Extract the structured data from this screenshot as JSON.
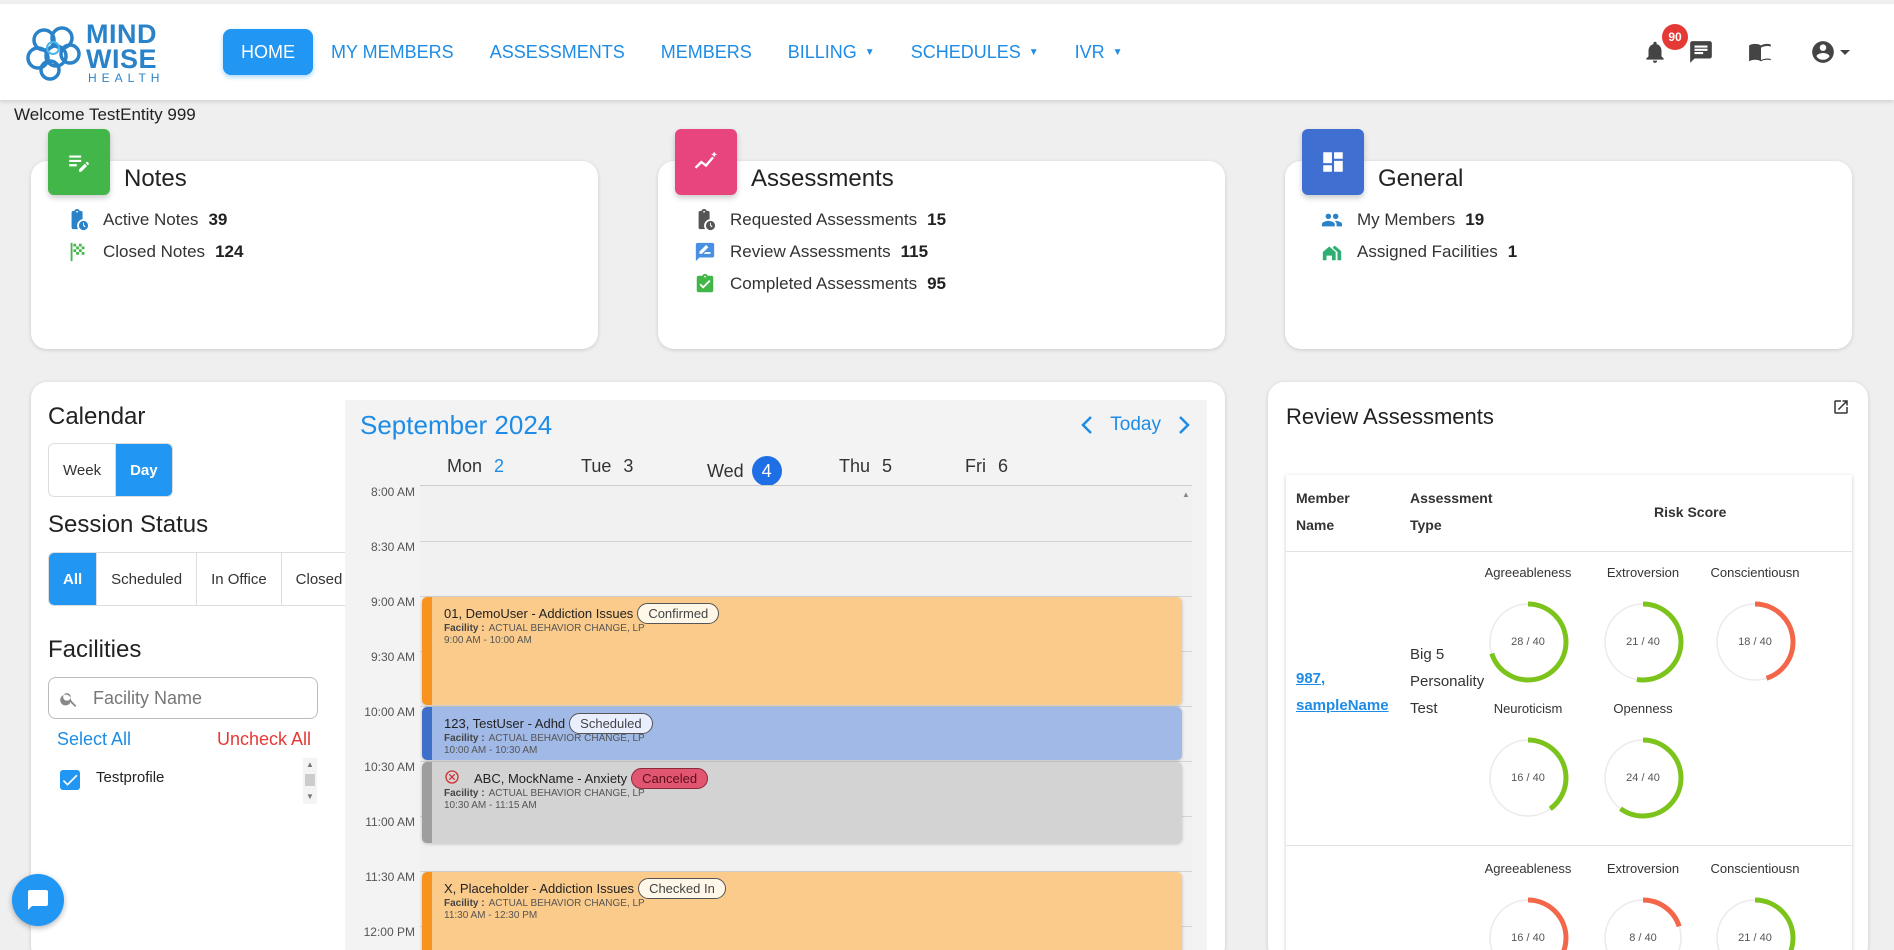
{
  "logo": {
    "line1": "MIND",
    "line2": "WISE",
    "sub": "HEALTH"
  },
  "nav": [
    {
      "label": "HOME",
      "active": true,
      "dropdown": false
    },
    {
      "label": "MY MEMBERS",
      "active": false,
      "dropdown": false
    },
    {
      "label": "ASSESSMENTS",
      "active": false,
      "dropdown": false
    },
    {
      "label": "MEMBERS",
      "active": false,
      "dropdown": false
    },
    {
      "label": "BILLING",
      "active": false,
      "dropdown": true
    },
    {
      "label": "SCHEDULES",
      "active": false,
      "dropdown": true
    },
    {
      "label": "IVR",
      "active": false,
      "dropdown": true
    }
  ],
  "notifications": {
    "count": "90"
  },
  "welcome": "Welcome TestEntity 999",
  "cards": {
    "notes": {
      "title": "Notes",
      "rows": [
        {
          "label": "Active Notes",
          "value": "39"
        },
        {
          "label": "Closed Notes",
          "value": "124"
        }
      ]
    },
    "assessments": {
      "title": "Assessments",
      "rows": [
        {
          "label": "Requested Assessments",
          "value": "15"
        },
        {
          "label": "Review Assessments",
          "value": "115"
        },
        {
          "label": "Completed Assessments",
          "value": "95"
        }
      ]
    },
    "general": {
      "title": "General",
      "rows": [
        {
          "label": "My Members",
          "value": "19"
        },
        {
          "label": "Assigned Facilities",
          "value": "1"
        }
      ]
    }
  },
  "calendar": {
    "title": "Calendar",
    "views": [
      "Week",
      "Day"
    ],
    "active_view": "Day",
    "session_status_title": "Session Status",
    "statuses": [
      "All",
      "Scheduled",
      "In Office",
      "Closed"
    ],
    "active_status": "All",
    "facilities_title": "Facilities",
    "facility_placeholder": "Facility Name",
    "select_all": "Select All",
    "uncheck_all": "Uncheck All",
    "facility_items": [
      {
        "name": "Testprofile",
        "checked": true
      }
    ],
    "month": "September 2024",
    "today": "Today",
    "days": [
      {
        "name": "Mon",
        "num": "2"
      },
      {
        "name": "Tue",
        "num": "3"
      },
      {
        "name": "Wed",
        "num": "4",
        "selected": true
      },
      {
        "name": "Thu",
        "num": "5"
      },
      {
        "name": "Fri",
        "num": "6"
      }
    ],
    "time_labels": [
      "8:00 AM",
      "8:30 AM",
      "9:00 AM",
      "9:30 AM",
      "10:00 AM",
      "10:30 AM",
      "11:00 AM",
      "11:30 AM",
      "12:00 PM"
    ],
    "events": [
      {
        "title": "01, DemoUser - Addiction Issues",
        "status": "Confirmed",
        "facility_label": "Facility :",
        "facility": "ACTUAL BEHAVIOR CHANGE, LP",
        "time": "9:00 AM - 10:00 AM",
        "color": "#fbcb8c",
        "bar": "#f7931e",
        "chip_bg": "#fff7e8",
        "canceled": false
      },
      {
        "title": "123, TestUser - Adhd",
        "status": "Scheduled",
        "facility_label": "Facility :",
        "facility": "ACTUAL BEHAVIOR CHANGE, LP",
        "time": "10:00 AM - 10:30 AM",
        "color": "#a1b9e6",
        "bar": "#3f6fc9",
        "chip_bg": "#e9efff",
        "canceled": false
      },
      {
        "title": "ABC, MockName - Anxiety",
        "status": "Canceled",
        "facility_label": "Facility :",
        "facility": "ACTUAL BEHAVIOR CHANGE, LP",
        "time": "10:30 AM - 11:15 AM",
        "color": "#d3d3d3",
        "bar": "#9e9e9e",
        "chip_bg": "#e25570",
        "canceled": true
      },
      {
        "title": "X, Placeholder - Addiction Issues",
        "status": "Checked In",
        "facility_label": "Facility :",
        "facility": "ACTUAL BEHAVIOR CHANGE, LP",
        "time": "11:30 AM - 12:30 PM",
        "color": "#fbcb8c",
        "bar": "#f7931e",
        "chip_bg": "#fff7e8",
        "canceled": false
      }
    ]
  },
  "review": {
    "title": "Review Assessments",
    "headers": {
      "member_name": "Member Name",
      "assessment_type": "Assessment Type",
      "risk_score": "Risk Score"
    },
    "rows": [
      {
        "member": "987, sampleName",
        "type": "Big 5 Personality Test",
        "traits": [
          {
            "name": "Agreeableness",
            "score": 28,
            "max": 40,
            "label": "28 / 40",
            "color": "#7cc41c"
          },
          {
            "name": "Extroversion",
            "score": 21,
            "max": 40,
            "label": "21 / 40",
            "color": "#7cc41c"
          },
          {
            "name": "Conscientiousn",
            "score": 18,
            "max": 40,
            "label": "18 / 40",
            "color": "#f4664a"
          },
          {
            "name": "Neuroticism",
            "score": 16,
            "max": 40,
            "label": "16 / 40",
            "color": "#7cc41c"
          },
          {
            "name": "Openness",
            "score": 24,
            "max": 40,
            "label": "24 / 40",
            "color": "#7cc41c"
          }
        ]
      },
      {
        "member": "",
        "type": "",
        "traits": [
          {
            "name": "Agreeableness",
            "score": 16,
            "max": 40,
            "label": "16 / 40",
            "color": "#f4664a"
          },
          {
            "name": "Extroversion",
            "score": 8,
            "max": 40,
            "label": "8 / 40",
            "color": "#f4664a"
          },
          {
            "name": "Conscientiousn",
            "score": 21,
            "max": 40,
            "label": "21 / 40",
            "color": "#7cc41c"
          }
        ]
      }
    ]
  },
  "colors": {
    "primary": "#2196f3",
    "notes_tile": "#43b649",
    "assess_tile": "#e8457e",
    "general_tile": "#3f6fd1",
    "danger": "#e53935"
  }
}
